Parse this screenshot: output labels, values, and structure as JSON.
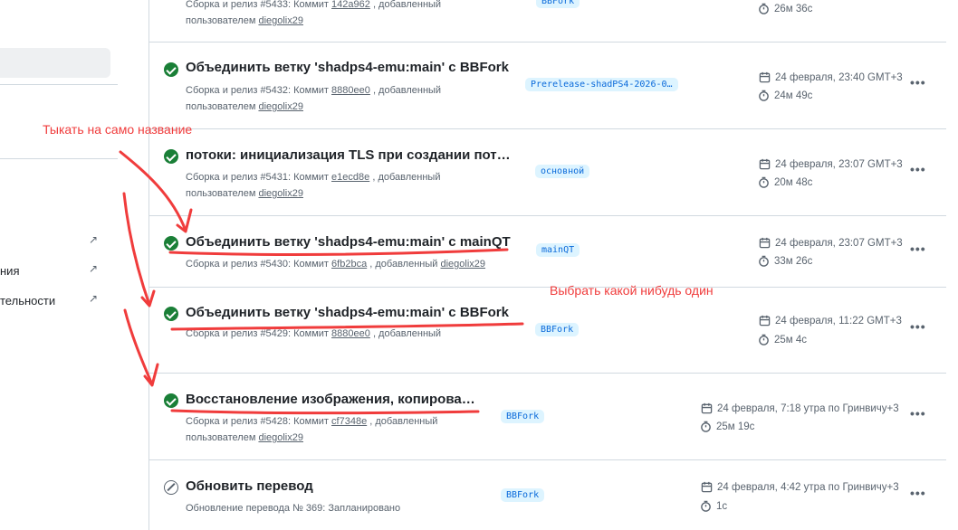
{
  "sidebar": {
    "items": [
      {
        "label": "ния",
        "external": true
      },
      {
        "label": "тельности",
        "external": true
      }
    ],
    "external_icon": "arrow-up-right-icon"
  },
  "runs": [
    {
      "status": "success",
      "title": "",
      "meta_prefix": "Сборка и релиз #5433: Коммит",
      "commit": "142a962",
      "meta_mid": ", добавленный",
      "meta_by": "пользователем",
      "user": "diegolix29",
      "branch": "BBFork",
      "date": "",
      "duration": "26м 36с"
    },
    {
      "status": "success",
      "title": "Объединить ветку 'shadps4-emu:main' с BBFork",
      "meta_prefix": "Сборка и релиз #5432: Коммит",
      "commit": "8880ee0",
      "meta_mid": ", добавленный",
      "meta_by": "пользователем",
      "user": "diegolix29",
      "branch": "Prerelease-shadPS4-2026-0…",
      "date": "24 февраля, 23:40 GMT+3",
      "duration": "24м 49с"
    },
    {
      "status": "success",
      "title": "потоки: инициализация TLS при создании пот…",
      "meta_prefix": "Сборка и релиз #5431: Коммит",
      "commit": "e1ecd8e",
      "meta_mid": ", добавленный",
      "meta_by": "пользователем",
      "user": "diegolix29",
      "branch": "основной",
      "date": "24 февраля, 23:07 GMT+3",
      "duration": "20м 48с"
    },
    {
      "status": "success",
      "title": "Объединить ветку 'shadps4-emu:main' с mainQT",
      "meta_prefix": "Сборка и релиз #5430: Коммит",
      "commit": "6fb2bca",
      "meta_mid": ", добавленный",
      "meta_by": "",
      "user": "diegolix29",
      "branch": "mainQT",
      "date": "24 февраля, 23:07 GMT+3",
      "duration": "33м 26с"
    },
    {
      "status": "success",
      "title": "Объединить ветку 'shadps4-emu:main' с BBFork",
      "meta_prefix": "Сборка и релиз #5429: Коммит",
      "commit": "8880ee0",
      "meta_mid": ", добавленный",
      "meta_by": "",
      "user": "",
      "branch": "BBFork",
      "date": "24 февраля, 11:22 GMT+3",
      "duration": "25м 4с"
    },
    {
      "status": "success",
      "title": "Восстановление изображения, копирова…",
      "meta_prefix": "Сборка и релиз #5428: Коммит",
      "commit": "cf7348e",
      "meta_mid": ", добавленный",
      "meta_by": "пользователем",
      "user": "diegolix29",
      "branch": "BBFork",
      "date": "24 февраля, 7:18 утра по Гринвичу+3",
      "duration": "25м 19с"
    },
    {
      "status": "skipped",
      "title": "Обновить перевод",
      "meta_prefix": "Обновление перевода № 369: Запланировано",
      "commit": "",
      "meta_mid": "",
      "meta_by": "",
      "user": "",
      "branch": "BBFork",
      "date": "24 февраля, 4:42 утра по Гринвичу+3",
      "duration": "1с"
    }
  ],
  "more_icon": "kebab-horizontal-icon",
  "annotations": {
    "tap_title": "Тыкать на само название",
    "pick_one": "Выбрать какой нибудь один",
    "color": "#f03c3c"
  },
  "colors": {
    "success": "#1a7f37",
    "branch_bg": "#ddf4ff",
    "branch_fg": "#0969da",
    "muted": "#59636e"
  }
}
